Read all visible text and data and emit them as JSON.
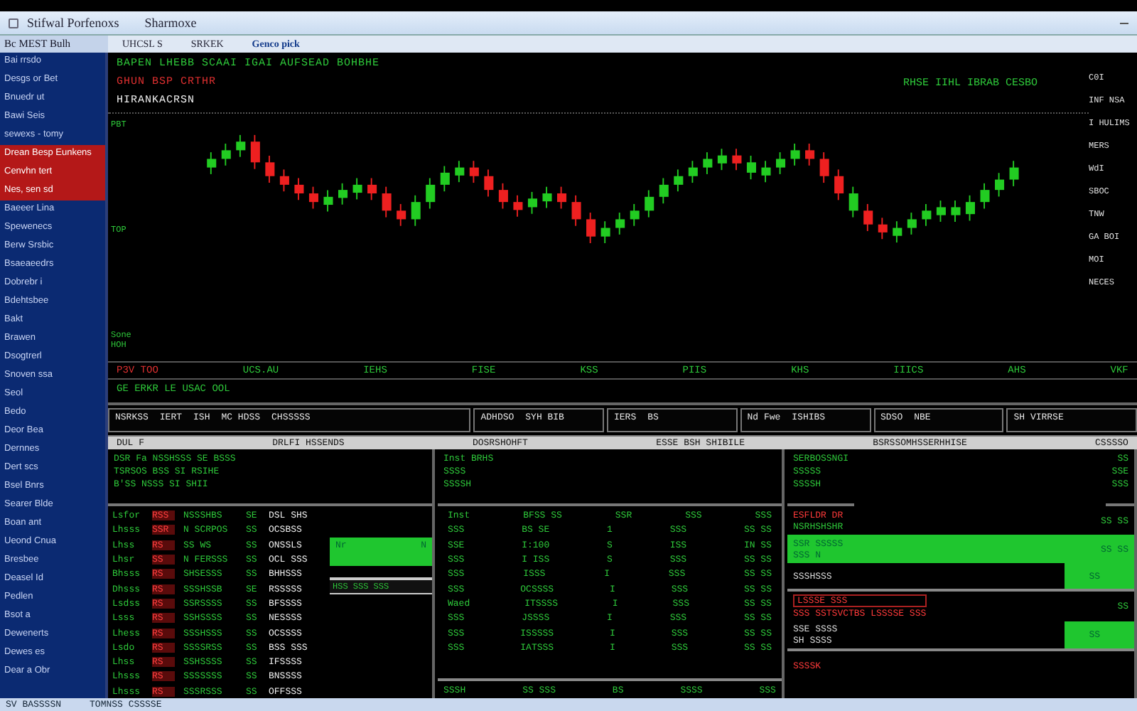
{
  "window": {
    "title": "Stifwal Porfenoxs",
    "subtitle": "Sharmoxe"
  },
  "toolbar": {
    "label": "Bc MEST Bulh",
    "tabs": [
      {
        "label": "UHCSL S",
        "selected": false
      },
      {
        "label": "SRKEK",
        "selected": false
      },
      {
        "label": "Genco pick",
        "selected": true
      }
    ]
  },
  "sidebar": {
    "items": [
      {
        "label": "Bai rrsdo",
        "selected": false
      },
      {
        "label": "Desgs or Bet",
        "selected": false
      },
      {
        "label": "Bnuedr ut",
        "selected": false
      },
      {
        "label": "Bawi Seis",
        "selected": false
      },
      {
        "label": "sewexs - tomy",
        "selected": false
      },
      {
        "label": "Drean Besp Eunkens",
        "selected": true
      },
      {
        "label": "Cenvhn tert",
        "selected": true
      },
      {
        "label": "Nes, sen sd",
        "selected": true
      },
      {
        "label": "Baeeer Lina",
        "selected": false
      },
      {
        "label": "Spewenecs",
        "selected": false
      },
      {
        "label": "Berw Srsbic",
        "selected": false
      },
      {
        "label": "Bsaeaeedrs",
        "selected": false
      },
      {
        "label": "Dobrebr i",
        "selected": false
      },
      {
        "label": "Bdehtsbee",
        "selected": false
      },
      {
        "label": "Bakt",
        "selected": false
      },
      {
        "label": "Brawen",
        "selected": false
      },
      {
        "label": "Dsogtrerl",
        "selected": false
      },
      {
        "label": "Snoven ssa",
        "selected": false
      },
      {
        "label": "Seol",
        "selected": false
      },
      {
        "label": "Bedo",
        "selected": false
      },
      {
        "label": "Deor Bea",
        "selected": false
      },
      {
        "label": "Dernnes",
        "selected": false
      },
      {
        "label": "Dert scs",
        "selected": false
      },
      {
        "label": "Bsel Bnrs",
        "selected": false
      },
      {
        "label": "Searer Blde",
        "selected": false
      },
      {
        "label": "Boan ant",
        "selected": false
      },
      {
        "label": "Ueond Cnua",
        "selected": false
      },
      {
        "label": "Bresbee",
        "selected": false
      },
      {
        "label": "Deasel Id",
        "selected": false
      },
      {
        "label": "Pedlen",
        "selected": false
      },
      {
        "label": "Bsot a",
        "selected": false
      },
      {
        "label": "Dewenerts",
        "selected": false
      },
      {
        "label": "Dewes es",
        "selected": false
      },
      {
        "label": "Dear a Obr",
        "selected": false
      }
    ]
  },
  "chart": {
    "headlines": [
      {
        "text": "BAPEN  LHEBB  SCAAI  IGAI  AUFSEAD BOHBHE",
        "color": "#2ec93a"
      },
      {
        "text": "GHUN BSP CRTHR",
        "color": "#e03030"
      },
      {
        "text": "HIRANKACRSN",
        "color": "#f0f0f0"
      }
    ],
    "quote": "RHSE IIHL IBRAB CESBO",
    "axis_labels": [
      "PBT",
      "TOP",
      "Sone HOH"
    ],
    "side_labels": [
      "C0I",
      "INF NSA",
      "I HULIMS",
      "MERS",
      "WdI",
      "SBOC",
      "TNW",
      "GA BOI",
      "MOI",
      "NECES"
    ]
  },
  "ticker": [
    {
      "text": "P3V TOO",
      "color": "#e03030"
    },
    {
      "text": "UCS.AU",
      "color": "#2ec93a"
    },
    {
      "text": "IEHS",
      "color": "#2ec93a"
    },
    {
      "text": "FISE",
      "color": "#2ec93a"
    },
    {
      "text": "KSS",
      "color": "#2ec93a"
    },
    {
      "text": "PIIS",
      "color": "#2ec93a"
    },
    {
      "text": "KHS",
      "color": "#2ec93a"
    },
    {
      "text": "IIICS",
      "color": "#2ec93a"
    },
    {
      "text": "AHS",
      "color": "#2ec93a"
    },
    {
      "text": "VKF",
      "color": "#2ec93a"
    }
  ],
  "message": "GE ERKR LE USAC OOL",
  "summary": [
    {
      "texts": [
        "NSRKSS",
        "IERT",
        "ISH",
        "MC HDSS",
        "CHSSSSS"
      ]
    },
    {
      "texts": [
        "ADHDSO",
        "SYH BIB"
      ]
    },
    {
      "texts": [
        "IERS",
        "BS"
      ]
    },
    {
      "texts": [
        "Nd Fwe",
        "ISHIBS"
      ]
    },
    {
      "texts": [
        "SDSO",
        "NBE"
      ]
    },
    {
      "texts": [
        "SH VIRRSE"
      ]
    }
  ],
  "header_bar": [
    "DUL F",
    "DRLFI HSSENDS",
    "DOSRSHOHFT",
    "ESSE BSH SHIBILE",
    "BSRSSOMHSSERHHISE",
    "CSSSSO"
  ],
  "left_panel": {
    "lines": [
      "DSR Fa  NSSHSSS  SE  BSSS",
      "TSRSOS BSS  SI  RSIHE",
      "B'SS  NSSS  SI  SHII"
    ],
    "rows": [
      [
        "Lsfor",
        "RSS",
        "NSSSHBS",
        "SE",
        "DSL SHS"
      ],
      [
        "Lhsss",
        "SSR",
        "N SCRPOS",
        "SS",
        "OCSBSS"
      ],
      [
        "Lhss",
        "RS",
        "SS WS",
        "SS",
        "ONSSLS"
      ],
      [
        "Lhsr",
        "SS",
        "N FERSSS",
        "SS",
        "OCL SSS"
      ],
      [
        "Bhsss",
        "RS",
        "SHSESSS",
        "SS",
        "BHHSSS"
      ],
      [
        "Dhsss",
        "RS",
        "SSSHSSB",
        "SE",
        "RSSSSS"
      ],
      [
        "Lsdss",
        "RS",
        "SSRSSSS",
        "SS",
        "BFSSSS"
      ],
      [
        "Lsss",
        "RS",
        "SSHSSSS",
        "SS",
        "NESSSS"
      ],
      [
        "Lhess",
        "RS",
        "SSSHSSS",
        "SS",
        "OCSSSS"
      ],
      [
        "Lsdo",
        "RS",
        "SSSSRSS",
        "SS",
        "BSS SSS"
      ],
      [
        "Lhss",
        "RS",
        "SSHSSSS",
        "SS",
        "IFSSSS"
      ],
      [
        "Lhsss",
        "RS",
        "SSSSSSS",
        "SS",
        "BNSSSS"
      ],
      [
        "Lhsss",
        "RS",
        "SSSRSSS",
        "SS",
        "OFFSSS"
      ]
    ],
    "green_box": {
      "left": "Nr",
      "right": "N"
    },
    "strip": "HSS SSS SSS"
  },
  "middle_panel": {
    "lines": [
      "Inst BRHS",
      "SSSS",
      "SSSSH"
    ],
    "rows": [
      [
        "Inst",
        "BFSS SS",
        "SSR",
        "SSS",
        "SSS"
      ],
      [
        "SSS",
        "BS SE",
        "1",
        "SSS",
        "SS SS"
      ],
      [
        "SSE",
        "I:100",
        "S",
        "ISS",
        "IN SS"
      ],
      [
        "SSS",
        "I ISS",
        "S",
        "SSS",
        "SS SS"
      ],
      [
        "SSS",
        "ISSS",
        "I",
        "SSS",
        "SS SS"
      ],
      [
        "SSS",
        "OCSSSS",
        "I",
        "SSS",
        "SS SS"
      ],
      [
        "Waed",
        "ITSSSS",
        "I",
        "SSS",
        "SS SS"
      ],
      [
        "SSS",
        "JSSSS",
        "I",
        "SSS",
        "SS SS"
      ],
      [
        "SSS",
        "ISSSSS",
        "I",
        "SSS",
        "SS SS"
      ],
      [
        "SSS",
        "IATSSS",
        "I",
        "SSS",
        "SS SS"
      ]
    ],
    "footer": [
      "SSSH",
      "SS SSS",
      "BS",
      "SSSS",
      "SSS"
    ]
  },
  "right_panel": {
    "lines": [
      "SERBOSSNGI",
      "SSSSS",
      "SSSSH"
    ],
    "side": [
      "SS",
      "SSE",
      "SSS"
    ],
    "alerts": [
      {
        "kind": "heading",
        "title": "ESFLDR DR",
        "sub": "NSRHSHSHR",
        "side": "SS  SS"
      },
      {
        "kind": "bar",
        "title": "SSR SSSSS",
        "sub": "SSS N",
        "side": "SS  SS"
      },
      {
        "kind": "split",
        "title": "SSSHSSS",
        "side": "SS"
      },
      {
        "kind": "boxed",
        "title": "LSSSE SSS",
        "sub": "SSS SSTSVCTBS LSSSSE SSS",
        "side": "SS"
      },
      {
        "kind": "split",
        "title": "SSE SSSS",
        "sub": "SH SSSS",
        "side": "SS"
      },
      {
        "kind": "heading",
        "title": "SSSSK"
      }
    ]
  },
  "status_bar": [
    "SV BASSSSN",
    "TOMNSS CSSSSE"
  ]
}
